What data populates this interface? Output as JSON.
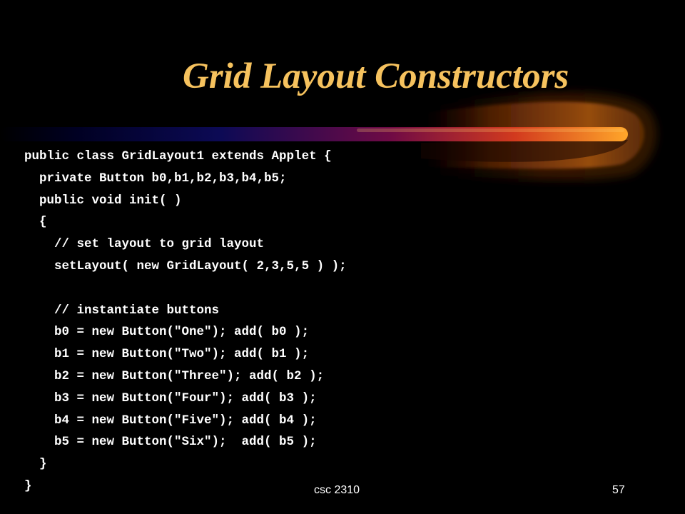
{
  "slide": {
    "title": "Grid Layout Constructors",
    "code_lines": [
      "public class GridLayout1 extends Applet {",
      "  private Button b0,b1,b2,b3,b4,b5;",
      "  public void init( )",
      "  {",
      "    // set layout to grid layout",
      "    setLayout( new GridLayout( 2,3,5,5 ) );",
      "",
      "    // instantiate buttons",
      "    b0 = new Button(\"One\"); add( b0 );",
      "    b1 = new Button(\"Two\"); add( b1 );",
      "    b2 = new Button(\"Three\"); add( b2 );",
      "    b3 = new Button(\"Four\"); add( b3 );",
      "    b4 = new Button(\"Five\"); add( b4 );",
      "    b5 = new Button(\"Six\");  add( b5 );",
      "  }",
      "}"
    ]
  },
  "footer": {
    "course": "csc 2310",
    "page_number": "57"
  },
  "colors": {
    "background": "#000000",
    "title": "#f6c25e",
    "text": "#ffffff",
    "swoosh_start": "#000033",
    "swoosh_mid": "#990044",
    "swoosh_end": "#ffaa22"
  }
}
